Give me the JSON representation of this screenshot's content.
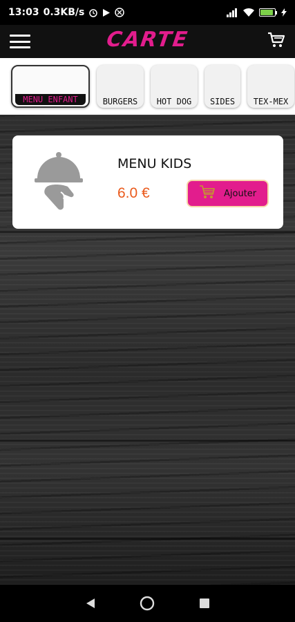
{
  "status_bar": {
    "time": "13:03",
    "net_speed": "0.3KB/s",
    "battery_level": "88",
    "battery_color": "#7dd04a"
  },
  "app_bar": {
    "title": "CARTE",
    "menu_icon": "hamburger-menu-icon",
    "cart_icon": "shopping-cart-icon"
  },
  "categories": {
    "tabs": [
      {
        "label": "MENU ENFANT",
        "active": true
      },
      {
        "label": "BURGERS",
        "active": false
      },
      {
        "label": "HOT DOG",
        "active": false
      },
      {
        "label": "SIDES",
        "active": false
      },
      {
        "label": "TEX-MEX",
        "active": false
      }
    ]
  },
  "product": {
    "name": "MENU KIDS",
    "price": "6.0 €",
    "add_label": "Ajouter",
    "image_icon": "cloche-serving-icon",
    "add_icon": "cart-icon"
  },
  "colors": {
    "accent": "#e21d8d",
    "price": "#ea5a1c"
  },
  "nav_bar": {
    "back_icon": "back-triangle-icon",
    "home_icon": "home-circle-icon",
    "recents_icon": "recents-square-icon"
  }
}
